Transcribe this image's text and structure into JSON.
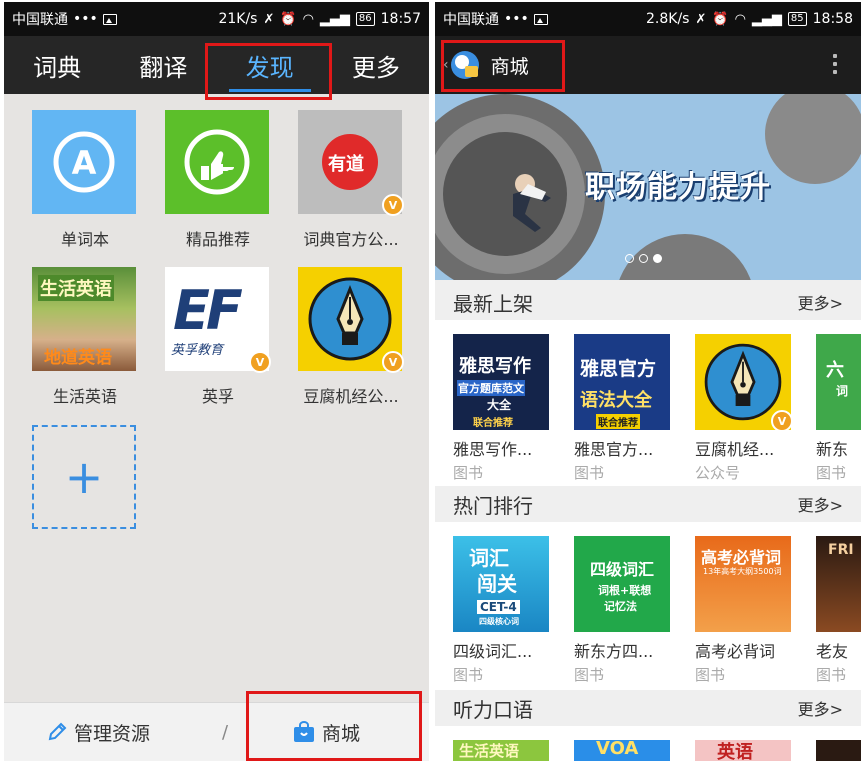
{
  "left": {
    "status": {
      "carrier": "中国联通",
      "dots": "•••",
      "speed": "21K/s",
      "battery": "86",
      "time": "18:57"
    },
    "tabs": [
      {
        "label": "词典",
        "active": false
      },
      {
        "label": "翻译",
        "active": false
      },
      {
        "label": "发现",
        "active": true
      },
      {
        "label": "更多",
        "active": false
      }
    ],
    "apps": [
      {
        "label": "单词本",
        "icon": "wordbook-icon",
        "glyph": "A"
      },
      {
        "label": "精品推荐",
        "icon": "thumbs-up-icon",
        "glyph": "👍"
      },
      {
        "label": "词典官方公...",
        "icon": "youdao-logo-icon",
        "glyph": "有道",
        "badge": "V"
      },
      {
        "label": "生活英语",
        "icon": "life-english-icon",
        "top": "生活英语",
        "bottom": "地道英语"
      },
      {
        "label": "英孚",
        "icon": "ef-logo-icon",
        "glyph": "EF",
        "sub": "英孚教育",
        "badge": "V"
      },
      {
        "label": "豆腐机经公...",
        "icon": "fountain-pen-icon",
        "badge": "V"
      }
    ],
    "add_label": "+",
    "bottom": {
      "manage_label": "管理资源",
      "separator": "/",
      "store_label": "商城"
    }
  },
  "right": {
    "status": {
      "carrier": "中国联通",
      "dots": "•••",
      "speed": "2.8K/s",
      "battery": "85",
      "time": "18:58"
    },
    "title": "商城",
    "banner_text": "职场能力提升",
    "sections": [
      {
        "title": "最新上架",
        "more": "更多>",
        "items": [
          {
            "title": "雅思写作...",
            "category": "图书"
          },
          {
            "title": "雅思官方...",
            "category": "图书"
          },
          {
            "title": "豆腐机经...",
            "category": "公众号"
          },
          {
            "title": "新东",
            "category": "图书"
          }
        ]
      },
      {
        "title": "热门排行",
        "more": "更多>",
        "items": [
          {
            "title": "四级词汇...",
            "category": "图书"
          },
          {
            "title": "新东方四...",
            "category": "图书"
          },
          {
            "title": "高考必背词",
            "category": "图书"
          },
          {
            "title": "老友",
            "category": "图书"
          }
        ]
      },
      {
        "title": "听力口语",
        "more": "更多>"
      }
    ],
    "covers": {
      "c1": [
        "雅思写作",
        "官方题库范文",
        "大全",
        "联合推荐"
      ],
      "c2": [
        "雅思官方",
        "语法大全",
        "联合推荐"
      ],
      "c4": [
        "六",
        "词"
      ],
      "h1": [
        "词汇",
        "闯关",
        "CET-4",
        "四级核心词"
      ],
      "h2": [
        "四级词汇",
        "词根+联想",
        "记忆法"
      ],
      "h3": [
        "高考必背词",
        "13年高考大纲3500词"
      ],
      "h4": [
        "FRI"
      ],
      "l1": [
        "生活英语"
      ],
      "l2": [
        "VOA"
      ],
      "l3": [
        "英语"
      ]
    }
  },
  "colors": {
    "accent": "#2f8ee8",
    "highlight": "#e01818"
  }
}
